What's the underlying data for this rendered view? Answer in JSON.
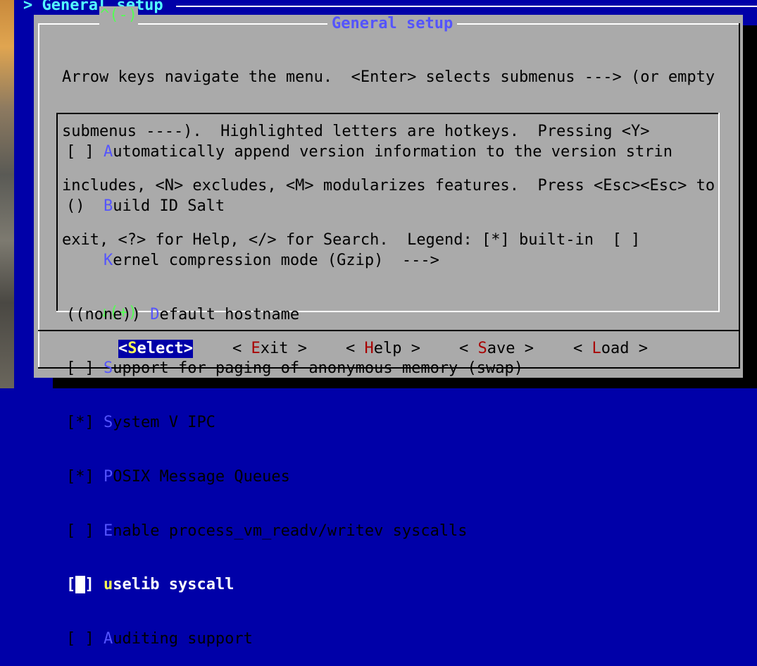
{
  "terminal": {
    "title": "> General setup"
  },
  "dialog": {
    "title": "General setup",
    "help_lines": [
      "Arrow keys navigate the menu.  <Enter> selects submenus ---> (or empty",
      "submenus ----).  Highlighted letters are hotkeys.  Pressing <Y>",
      "includes, <N> excludes, <M> modularizes features.  Press <Esc><Esc> to",
      "exit, <?> for Help, </> for Search.  Legend: [*] built-in  [ ]"
    ],
    "scroll_up": "^(-)",
    "scroll_down": "↓(+)"
  },
  "menu": {
    "items": [
      {
        "prefix": "[ ] ",
        "hotkey": "A",
        "rest": "utomatically append version information to the version strin"
      },
      {
        "prefix": "()  ",
        "hotkey": "B",
        "rest": "uild ID Salt"
      },
      {
        "prefix": "    ",
        "hotkey": "K",
        "rest": "ernel compression mode (Gzip)  --->"
      },
      {
        "prefix": "((none)) ",
        "hotkey": "D",
        "rest": "efault hostname"
      },
      {
        "prefix": "[ ] ",
        "hotkey": "S",
        "rest": "upport for paging of anonymous memory (swap)"
      },
      {
        "prefix": "[*] ",
        "hotkey": "S",
        "rest": "ystem V IPC"
      },
      {
        "prefix": "[*] ",
        "hotkey": "P",
        "rest": "OSIX Message Queues"
      },
      {
        "prefix": "[ ] ",
        "hotkey": "E",
        "rest": "nable process_vm_readv/writev syscalls"
      },
      {
        "prefix_open": "[",
        "prefix_cursor": " ",
        "prefix_close": "] ",
        "hotkey": "u",
        "rest": "selib syscall",
        "selected": true
      },
      {
        "prefix": "[ ] ",
        "hotkey": "A",
        "rest": "uditing support"
      }
    ]
  },
  "buttons": [
    {
      "open": "<",
      "hotkey": "S",
      "rest": "elect",
      "close": ">",
      "active": true
    },
    {
      "open": "< ",
      "hotkey": "E",
      "rest": "xit",
      "close": " >"
    },
    {
      "open": "< ",
      "hotkey": "H",
      "rest": "elp",
      "close": " >"
    },
    {
      "open": "< ",
      "hotkey": "S",
      "rest": "ave",
      "close": " >"
    },
    {
      "open": "< ",
      "hotkey": "L",
      "rest": "oad",
      "close": " >"
    }
  ],
  "colors": {
    "terminal_bg": "#0000a8",
    "dialog_bg": "#aaaaaa",
    "hotkey": "#5454fe",
    "title_cyan": "#54fefe",
    "scroll_green": "#54fe54",
    "button_hotkey": "#a80000",
    "selected_hotkey": "#ffff54"
  }
}
